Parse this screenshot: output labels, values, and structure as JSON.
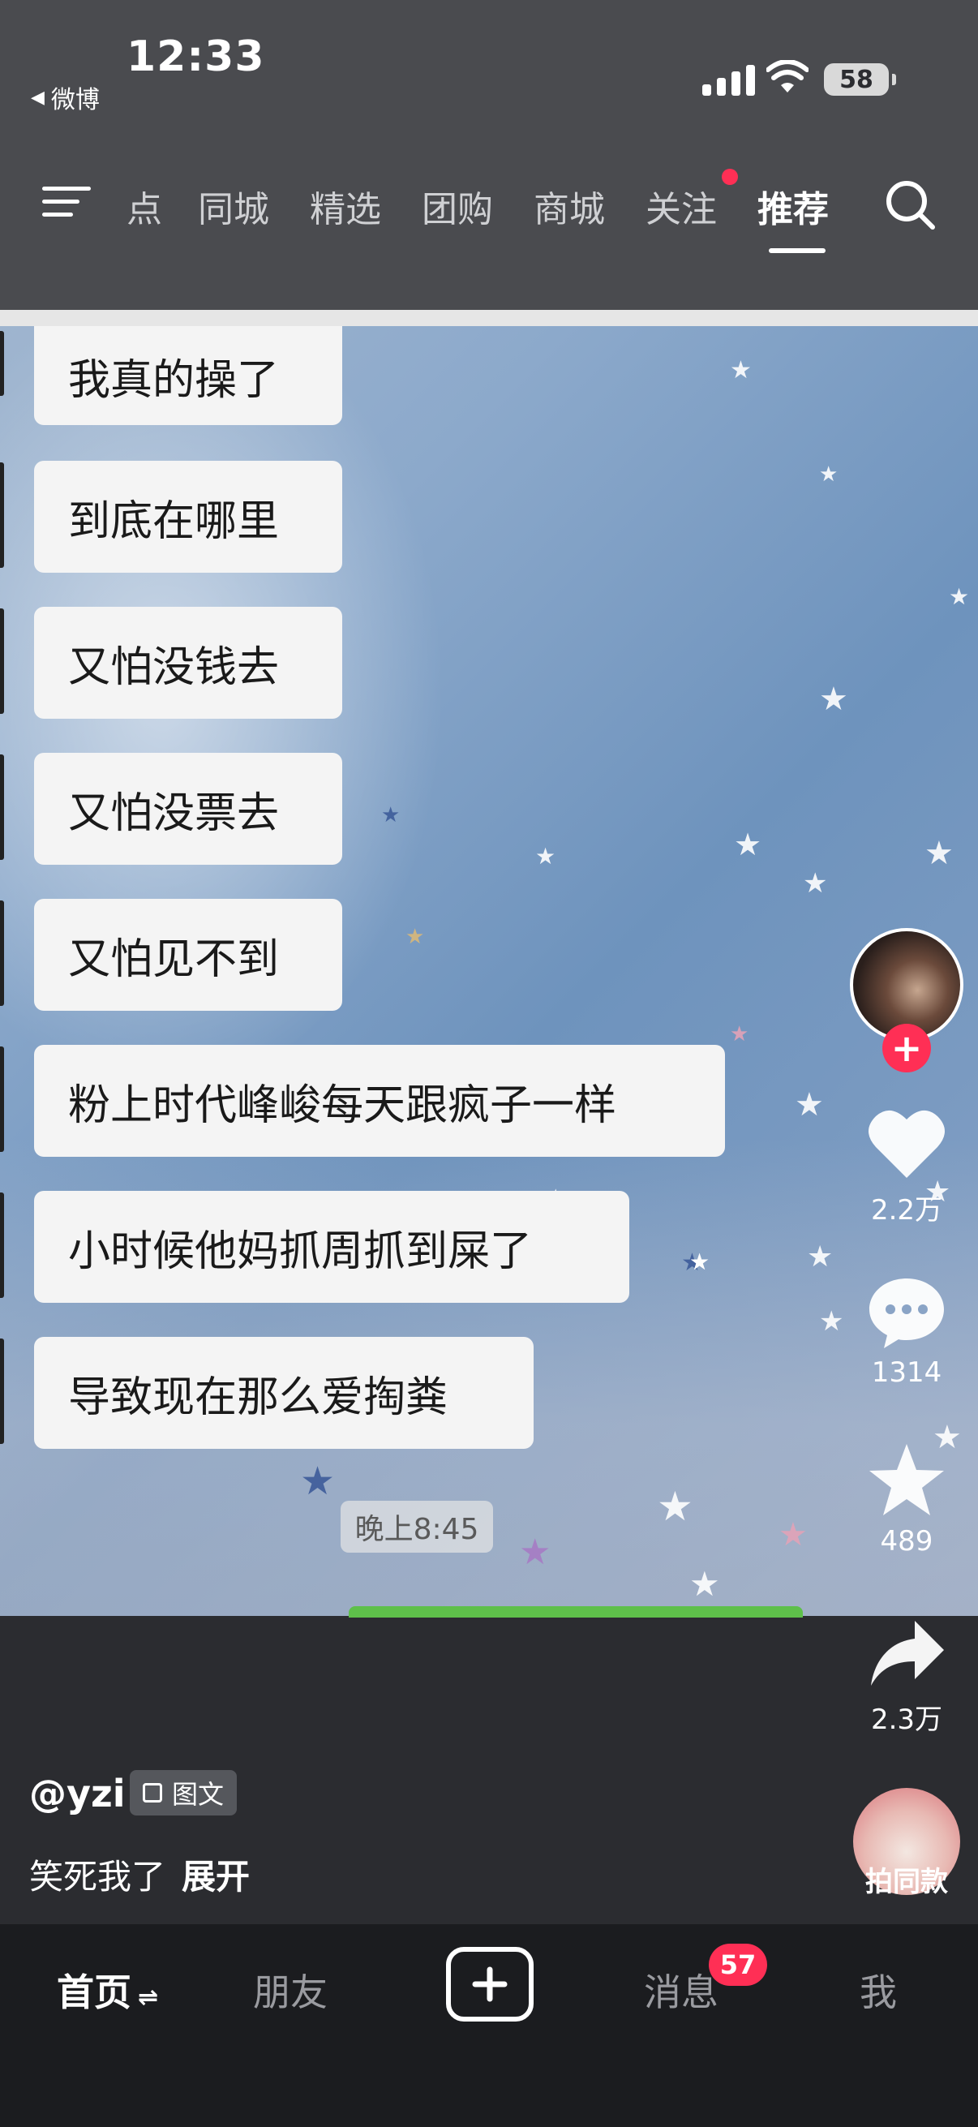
{
  "status_bar": {
    "back_app": "微博",
    "time": "12:33",
    "battery": "58"
  },
  "top_nav": {
    "tabs": [
      {
        "label": "点"
      },
      {
        "label": "同城"
      },
      {
        "label": "精选"
      },
      {
        "label": "团购"
      },
      {
        "label": "商城"
      },
      {
        "label": "关注"
      },
      {
        "label": "推荐"
      }
    ],
    "active_tab": "推荐",
    "accent_color": "#ff2f55"
  },
  "media": {
    "messages": [
      "我真的操了",
      "到底在哪里",
      "又怕没钱去",
      "又怕没票去",
      "又怕见不到",
      "粉上时代峰峻每天跟疯子一样",
      "小时候他妈抓周抓到屎了",
      "导致现在那么爱掏粪"
    ],
    "timestamp": "晚上8:45"
  },
  "actions": {
    "like_count": "2.2万",
    "comment_count": "1314",
    "favorite_count": "489",
    "share_count": "2.3万",
    "same_style_label": "拍同款"
  },
  "post": {
    "author": "@yzi",
    "type_label": "图文",
    "caption": "笑死我了",
    "expand_label": "展开"
  },
  "bottom_tabs": {
    "home": "首页",
    "friends": "朋友",
    "messages": "消息",
    "messages_badge": "57",
    "me": "我"
  },
  "icons": [
    "back-arrow-icon",
    "signal-icon",
    "wifi-icon",
    "battery-icon",
    "menu-icon",
    "search-icon",
    "heart-icon",
    "comment-icon",
    "star-icon",
    "share-icon",
    "plus-icon",
    "swap-icon",
    "image-text-icon"
  ]
}
